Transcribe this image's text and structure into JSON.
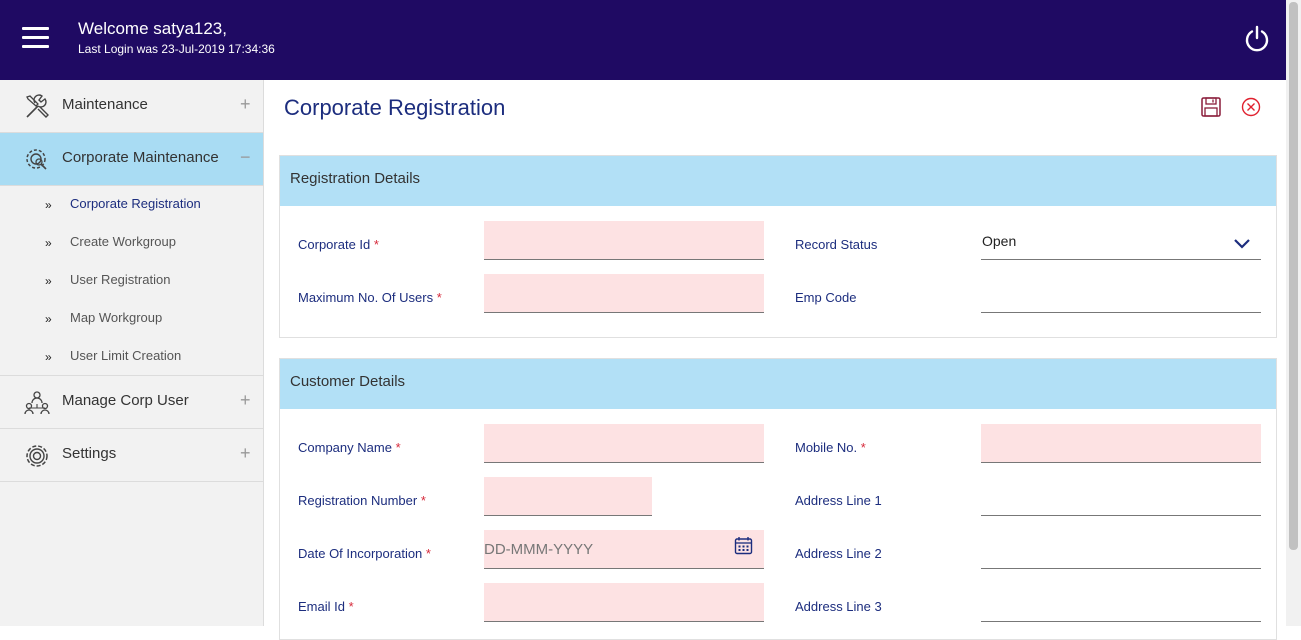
{
  "header": {
    "welcome": "Welcome satya123,",
    "last_login": "Last Login was 23-Jul-2019 17:34:36",
    "menu_icon": "hamburger-icon",
    "power_icon": "power-icon"
  },
  "sidebar": {
    "menus": [
      {
        "label": "Maintenance",
        "icon": "tools-icon",
        "toggle": "+"
      },
      {
        "label": "Corporate Maintenance",
        "icon": "gear-search-icon",
        "toggle": "−"
      },
      {
        "label": "Manage Corp User",
        "icon": "users-icon",
        "toggle": "+"
      },
      {
        "label": "Settings",
        "icon": "gear-icon",
        "toggle": "+"
      }
    ],
    "submenu": [
      {
        "label": "Corporate Registration"
      },
      {
        "label": "Create Workgroup"
      },
      {
        "label": "User Registration"
      },
      {
        "label": "Map Workgroup"
      },
      {
        "label": "User Limit Creation"
      }
    ],
    "submenu_icon": "»"
  },
  "page": {
    "title": "Corporate Registration",
    "save_icon": "save-icon",
    "close_icon": "close-icon"
  },
  "registration": {
    "heading": "Registration Details",
    "corporate_id_label": "Corporate Id",
    "corporate_id_value": "",
    "max_users_label": "Maximum No. Of Users",
    "max_users_value": "",
    "record_status_label": "Record Status",
    "record_status_value": "Open",
    "emp_code_label": "Emp Code",
    "emp_code_value": ""
  },
  "customer": {
    "heading": "Customer Details",
    "company_name_label": "Company Name",
    "registration_number_label": "Registration Number",
    "date_of_incorporation_label": "Date Of Incorporation",
    "date_placeholder": "DD-MMM-YYYY",
    "email_label": "Email Id",
    "mobile_label": "Mobile No.",
    "address1_label": "Address Line 1",
    "address2_label": "Address Line 2",
    "address3_label": "Address Line 3"
  },
  "required_mark": "*",
  "colors": {
    "header_bg": "#1f0a63",
    "active_menu_bg": "#a9dcf3",
    "panel_head_bg": "#b2e0f6",
    "required_field_bg": "#fde2e3",
    "accent_text": "#1c2d7e",
    "required_star": "#d6293a"
  }
}
